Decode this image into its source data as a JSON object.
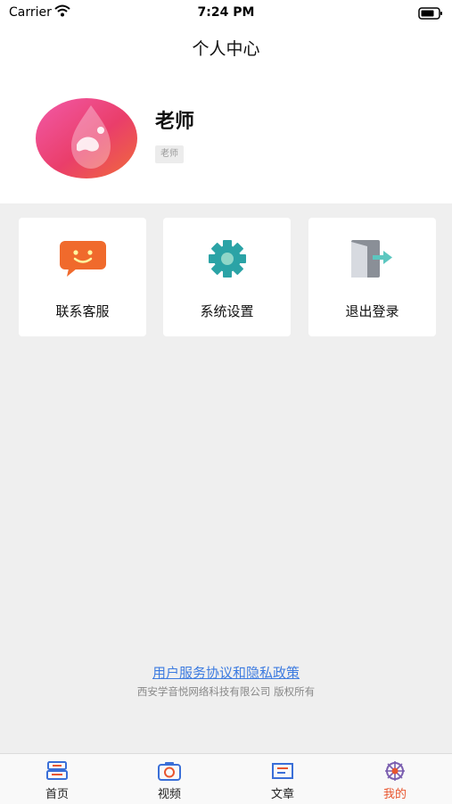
{
  "status": {
    "carrier": "Carrier",
    "time": "7:24 PM"
  },
  "header": {
    "title": "个人中心"
  },
  "profile": {
    "name": "老师",
    "role": "老师"
  },
  "menu": [
    {
      "label": "联系客服",
      "icon": "chat-icon"
    },
    {
      "label": "系统设置",
      "icon": "gear-icon"
    },
    {
      "label": "退出登录",
      "icon": "logout-icon"
    }
  ],
  "footer": {
    "policy": "用户服务协议和隐私政策",
    "copyright": "西安学音悦网络科技有限公司 版权所有"
  },
  "tabbar": [
    {
      "label": "首页",
      "icon": "home-icon"
    },
    {
      "label": "视频",
      "icon": "camera-icon"
    },
    {
      "label": "文章",
      "icon": "article-icon"
    },
    {
      "label": "我的",
      "icon": "profile-icon",
      "active": true
    }
  ],
  "colors": {
    "accent": "#e8552e",
    "link": "#3d7be0",
    "teal": "#2ba3a6",
    "orange": "#f06a2c"
  }
}
